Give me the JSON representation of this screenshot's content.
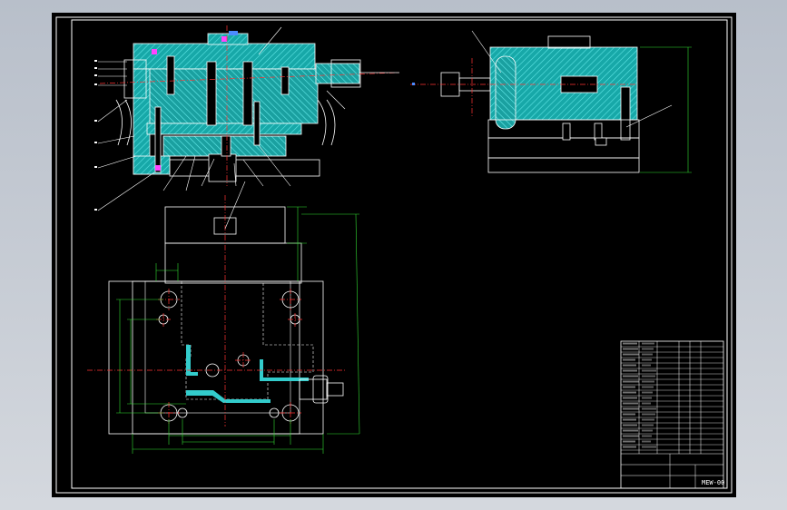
{
  "drawing": {
    "drawing_number": "MEW-00",
    "colors": {
      "viewport_bg": "#c9ced6",
      "sheet_bg": "#000000",
      "outline": "#ffffff",
      "hatch": "#33cccc",
      "center_line": "#ff3333",
      "dimension": "#33dd33",
      "leader": "#ffffff",
      "accent_magenta": "#ff44ff"
    }
  }
}
